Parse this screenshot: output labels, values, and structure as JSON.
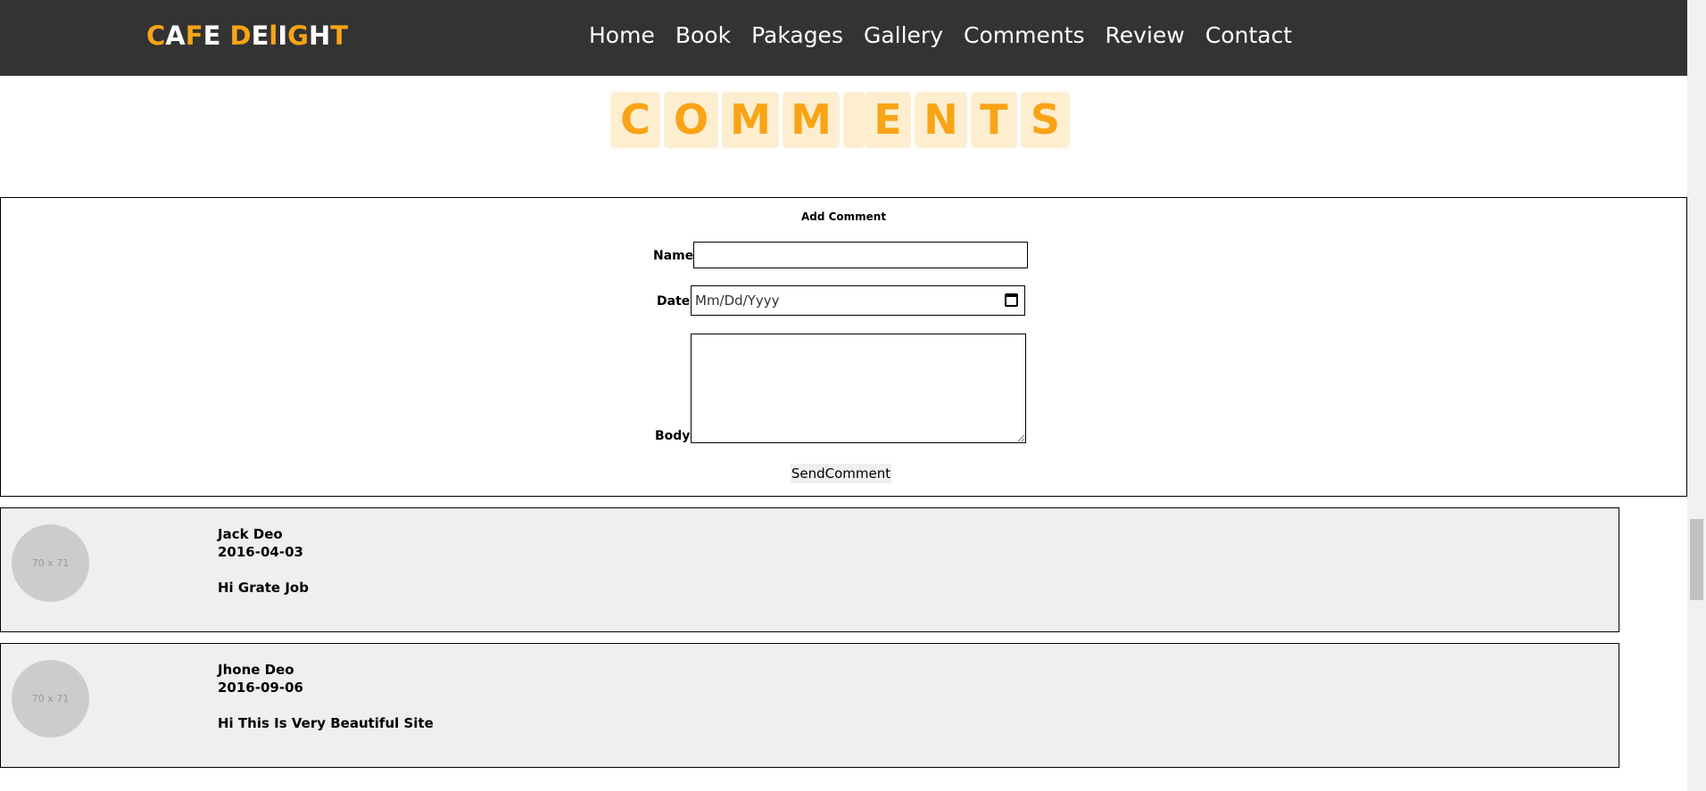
{
  "header": {
    "logo_parts": [
      {
        "text": "C",
        "tone": "orange"
      },
      {
        "text": "A",
        "tone": "white"
      },
      {
        "text": "F",
        "tone": "orange"
      },
      {
        "text": "E",
        "tone": "white"
      },
      {
        "text": " ",
        "tone": "white"
      },
      {
        "text": "D",
        "tone": "orange"
      },
      {
        "text": "E",
        "tone": "white"
      },
      {
        "text": "l",
        "tone": "orange"
      },
      {
        "text": "I",
        "tone": "white"
      },
      {
        "text": "G",
        "tone": "orange"
      },
      {
        "text": "H",
        "tone": "white"
      },
      {
        "text": "T",
        "tone": "orange"
      }
    ],
    "nav": [
      "Home",
      "Book",
      "Pakages",
      "Gallery",
      "Comments",
      "Review",
      "Contact"
    ]
  },
  "title_letters": [
    "C",
    "O",
    "M",
    "M",
    "",
    "E",
    "N",
    "T",
    "S"
  ],
  "form": {
    "title": "Add Comment",
    "name_label": "Name:",
    "name_value": "",
    "date_label": "Date:",
    "date_placeholder": "Mm/Dd/Yyyy",
    "body_label": "Body:",
    "body_value": "",
    "send_label": "SendComment"
  },
  "comments": [
    {
      "avatar_text": "70 x 71",
      "name": "Jack Deo",
      "date": "2016-04-03",
      "body": "Hi Grate Job"
    },
    {
      "avatar_text": "70 x 71",
      "name": "Jhone Deo",
      "date": "2016-09-06",
      "body": "Hi This Is Very Beautiful Site"
    }
  ],
  "colors": {
    "header_bg": "#333333",
    "accent": "#f9a416",
    "tile_bg": "#fdeed0",
    "comment_bg": "#efefef"
  }
}
